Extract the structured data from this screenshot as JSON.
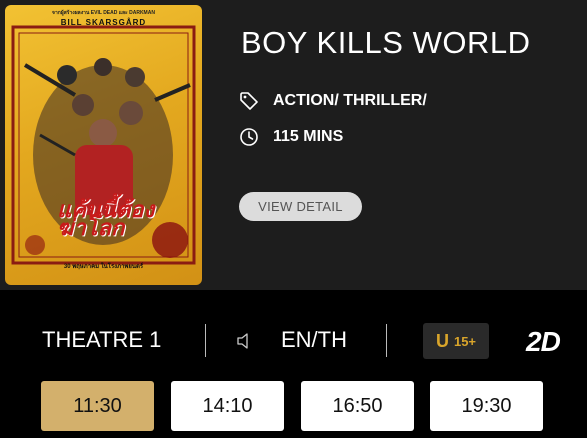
{
  "movie": {
    "title": "BOY KILLS WORLD",
    "genre": "ACTION/ THRILLER/",
    "duration": "115 MINS",
    "view_detail_label": "VIEW DETAIL",
    "poster": {
      "tagline": "จากผู้สร้างผลงาน EVIL DEAD และ DARKMAN",
      "actor": "BILL SKARSGÅRD",
      "thai_title": "แค้นนี้ต้องฆ่าโลก",
      "release_date": "30 พฤษภาคม ในโรงภาพยนตร์"
    }
  },
  "session": {
    "theatre": "THEATRE 1",
    "language": "EN/TH",
    "rating_prefix": "U",
    "rating_age": "15+",
    "format": "2D"
  },
  "showtimes": [
    {
      "time": "11:30",
      "selected": true
    },
    {
      "time": "14:10",
      "selected": false
    },
    {
      "time": "16:50",
      "selected": false
    },
    {
      "time": "19:30",
      "selected": false
    }
  ],
  "icons": {
    "genre": "tag-icon",
    "duration": "clock-icon",
    "audio": "speaker-icon"
  },
  "colors": {
    "accent_gold": "#d3b06c",
    "panel_bg": "#1d1d1d",
    "page_bg": "#000000",
    "rating_gold": "#d9a52b"
  }
}
